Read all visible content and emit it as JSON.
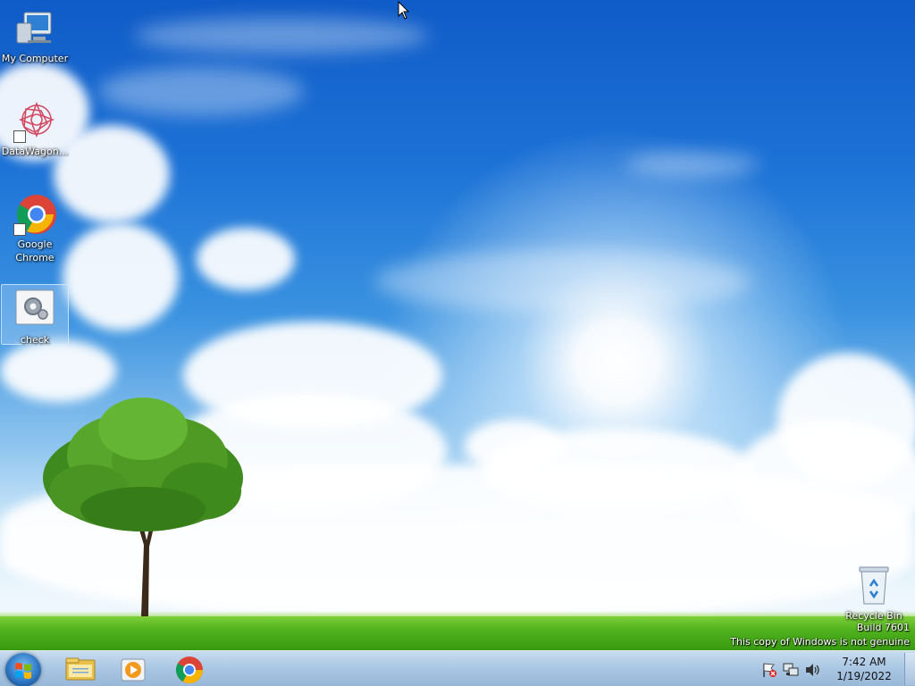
{
  "desktop_icons": [
    {
      "label": "My Computer",
      "icon": "my-computer-icon"
    },
    {
      "label": "DataWagon...",
      "icon": "datawagon-icon"
    },
    {
      "label": "Google Chrome",
      "icon": "chrome-icon"
    },
    {
      "label": "check",
      "icon": "settings-file-icon"
    },
    {
      "label": "Recycle Bin",
      "icon": "recycle-bin-icon"
    }
  ],
  "watermark": {
    "build": "Build 7601",
    "notice": "This copy of Windows is not genuine"
  },
  "taskbar": {
    "start_icon": "windows-start-icon",
    "pinned": [
      "file-explorer-icon",
      "media-player-icon",
      "chrome-icon"
    ],
    "tray_icons": [
      "action-center-icon",
      "network-icon",
      "volume-icon"
    ],
    "clock": {
      "time": "7:42 AM",
      "date": "1/19/2022"
    }
  },
  "colors": {
    "sky_top": "#0f5bc7",
    "grass": "#4fb21c",
    "taskbar": "#a9c6e3"
  }
}
